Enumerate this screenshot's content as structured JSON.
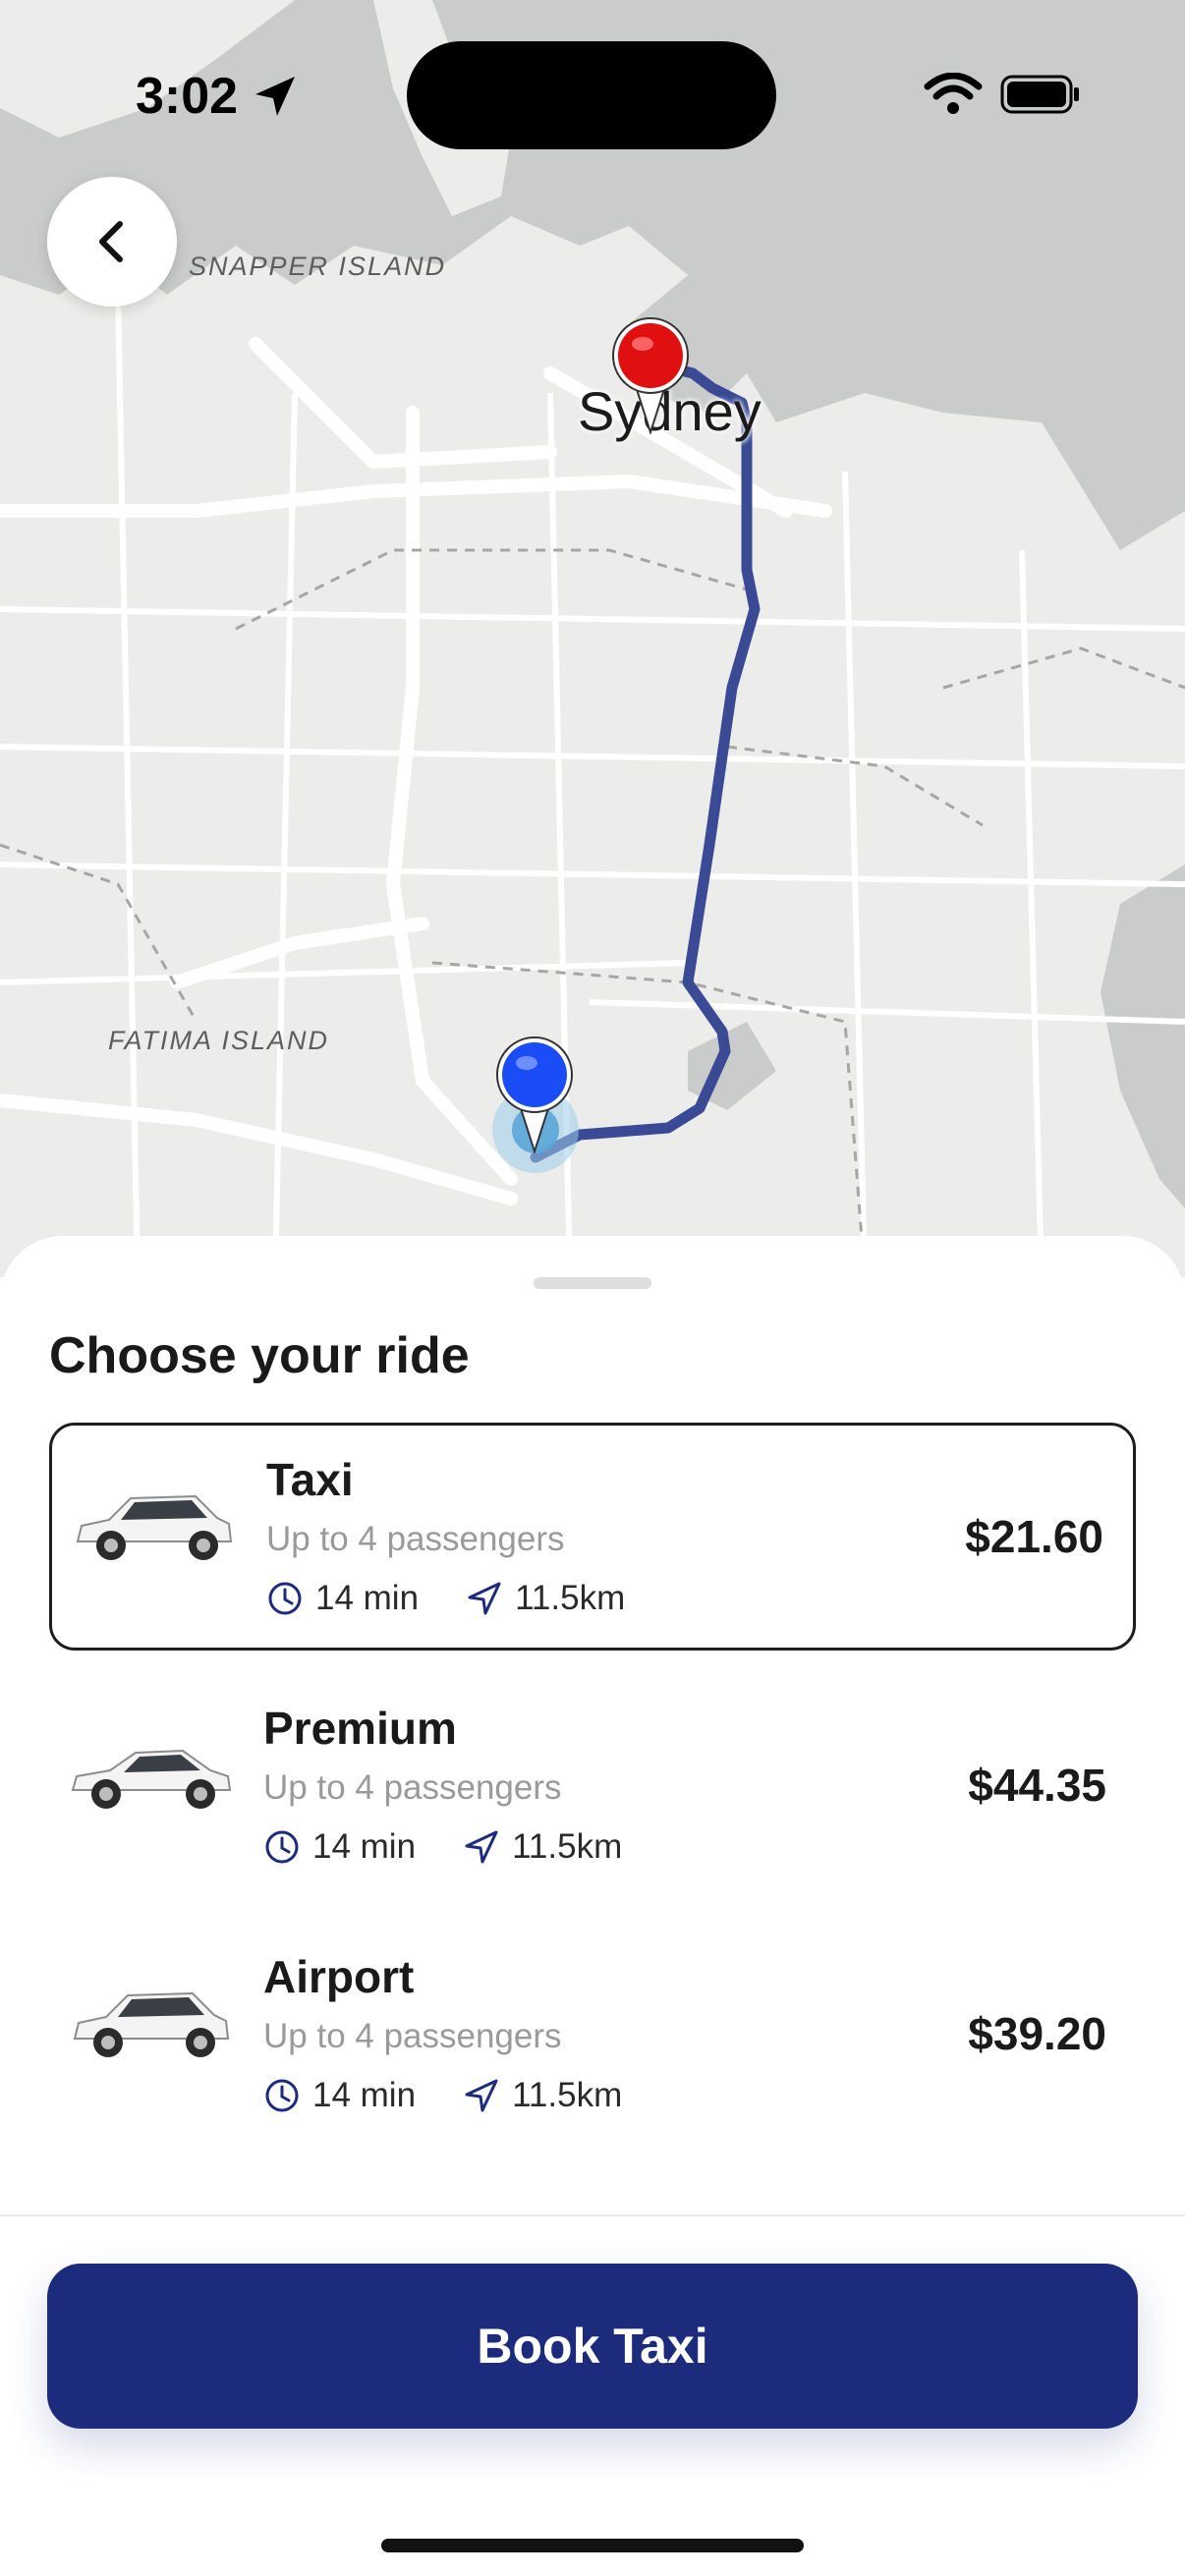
{
  "status_bar": {
    "time": "3:02"
  },
  "map": {
    "labels": {
      "island_1": "SNAPPER ISLAND",
      "island_2": "FATIMA ISLAND",
      "city": "Sydney"
    },
    "route_color": "#3a4a94",
    "origin_pin_color": "#1a4df5",
    "destination_pin_color": "#e01010"
  },
  "sheet": {
    "title": "Choose your ride",
    "rides": [
      {
        "name": "Taxi",
        "passengers": "Up to 4 passengers",
        "time": "14 min",
        "distance": "11.5km",
        "price": "$21.60",
        "selected": true
      },
      {
        "name": "Premium",
        "passengers": "Up to 4 passengers",
        "time": "14 min",
        "distance": "11.5km",
        "price": "$44.35",
        "selected": false
      },
      {
        "name": "Airport",
        "passengers": "Up to 4 passengers",
        "time": "14 min",
        "distance": "11.5km",
        "price": "$39.20",
        "selected": false
      }
    ],
    "book_button": "Book Taxi"
  },
  "colors": {
    "primary": "#1d2b7d",
    "water": "#c5c8c7",
    "land": "#ececea"
  },
  "icons": [
    "location-arrow-icon",
    "wifi-icon",
    "battery-icon",
    "back-chevron-icon",
    "clock-icon",
    "navigation-arrow-icon",
    "car-icon",
    "map-pin-icon"
  ]
}
